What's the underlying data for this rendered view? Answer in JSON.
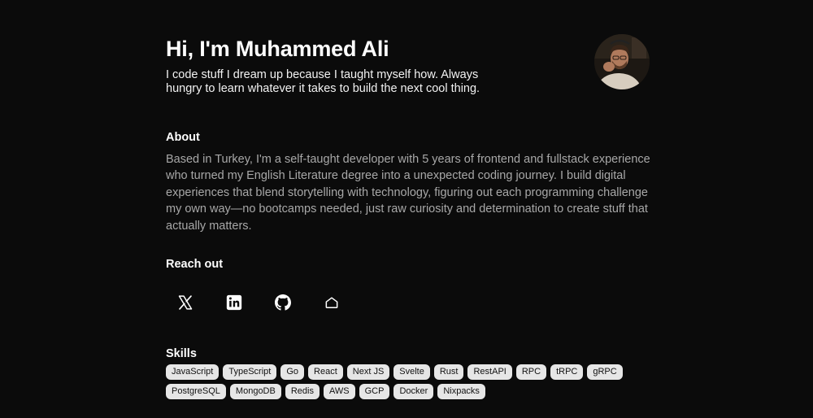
{
  "hero": {
    "title": "Hi, I'm Muhammed Ali",
    "tagline": "I code stuff I dream up because I taught myself how. Always hungry to learn whatever it takes to build the next cool thing."
  },
  "about": {
    "title": "About",
    "text": "Based in Turkey, I'm a self-taught developer with 5 years of frontend and fullstack experience who turned my English Literature degree into a unexpected coding journey. I build digital experiences that blend storytelling with technology, figuring out each programming challenge my own way—no bootcamps needed, just raw curiosity and determination to create stuff that actually matters."
  },
  "reach_out": {
    "title": "Reach out",
    "links": [
      {
        "icon": "x-icon"
      },
      {
        "icon": "linkedin-icon"
      },
      {
        "icon": "github-icon"
      },
      {
        "icon": "home-icon"
      }
    ]
  },
  "skills": {
    "title": "Skills",
    "items": [
      "JavaScript",
      "TypeScript",
      "Go",
      "React",
      "Next JS",
      "Svelte",
      "Rust",
      "RestAPI",
      "RPC",
      "tRPC",
      "gRPC",
      "PostgreSQL",
      "MongoDB",
      "Redis",
      "AWS",
      "GCP",
      "Docker",
      "Nixpacks"
    ]
  },
  "colors": {
    "background": "#0b0b0b",
    "text": "#ffffff",
    "muted_text": "#a8a8a8",
    "chip_background": "#e6e6e6"
  }
}
